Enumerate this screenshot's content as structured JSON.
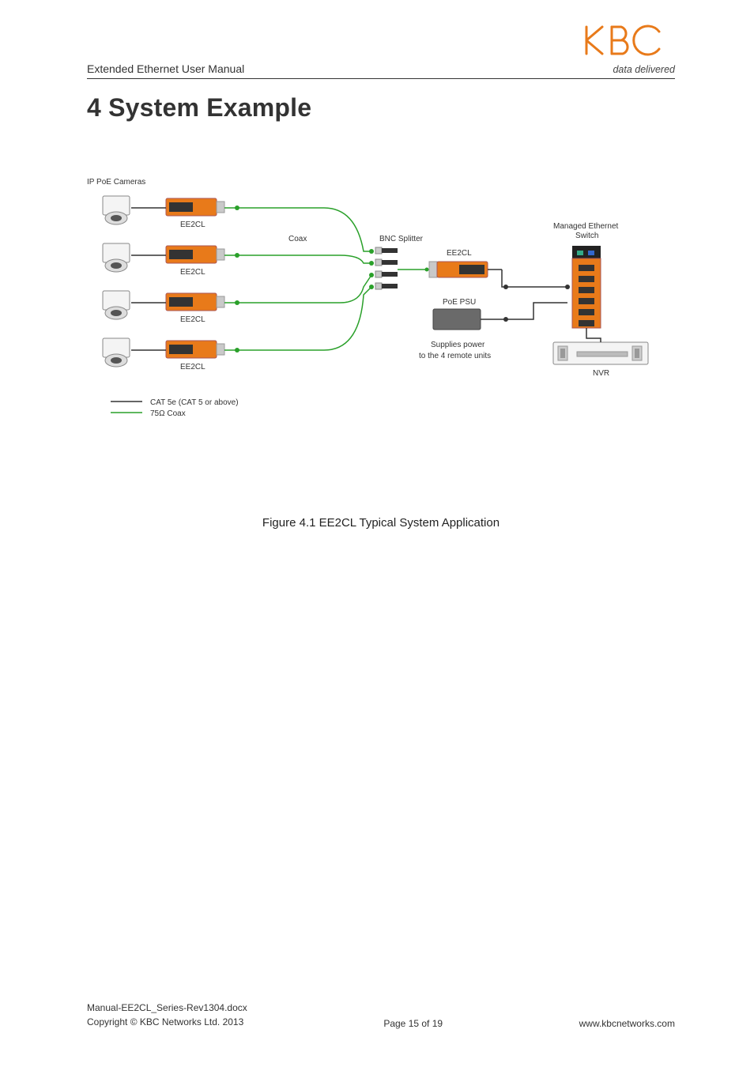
{
  "header": {
    "title": "Extended Ethernet User Manual",
    "tagline": "data delivered"
  },
  "section": {
    "heading": "4 System Example"
  },
  "diagram": {
    "top_label": "IP PoE Cameras",
    "ee2cl_label": "EE2CL",
    "coax_label": "Coax",
    "bnc_label": "BNC Splitter",
    "right_ee2cl": "EE2CL",
    "poe_psu": "PoE PSU",
    "supplies_line1": "Supplies power",
    "supplies_line2": "to the 4 remote units",
    "switch_line1": "Managed Ethernet",
    "switch_line2": "Switch",
    "nvr_label": "NVR",
    "legend_cat5e": "CAT 5e (CAT 5 or above)",
    "legend_coax": "75Ω Coax"
  },
  "figure_caption": "Figure 4.1 EE2CL Typical System Application",
  "footer": {
    "filename": "Manual-EE2CL_Series-Rev1304.docx",
    "copyright": "Copyright © KBC Networks Ltd. 2013",
    "page": "Page 15 of 19",
    "url": "www.kbcnetworks.com"
  }
}
